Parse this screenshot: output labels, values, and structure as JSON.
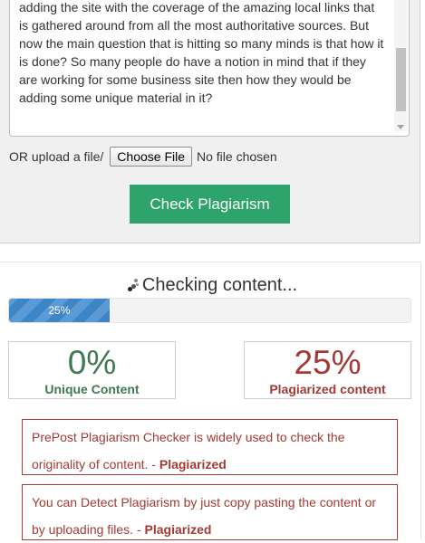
{
  "input": {
    "text": "adding the site with the coverage of the amazing local links that is gathered around from all the most authoritative sources. But now the main question that is hitting so many minds is that how it is done? So many people do have a notion in mind that if they are working for some business site then how they would be adding some unique material in it?"
  },
  "upload": {
    "label": "OR upload a file/",
    "button_label": "Choose File",
    "status": "No file chosen"
  },
  "check_button": {
    "label": "Check Plagiarism"
  },
  "status": {
    "checking_text": "Checking content...",
    "progress_percent": 25,
    "progress_label": "25%"
  },
  "stats": {
    "unique": {
      "value": "0%",
      "label": "Unique Content",
      "color": "#3d7a52"
    },
    "plagiarized": {
      "value": "25%",
      "label": "Plagiarized content",
      "color": "#a33a33"
    }
  },
  "results": [
    {
      "text": "PrePost Plagiarism Checker is widely used to check the originality of content. - ",
      "verdict": "Plagiarized"
    },
    {
      "text": "You can Detect Plagiarism by just copy pasting the content or by uploading files. - ",
      "verdict": "Plagiarized"
    }
  ],
  "colors": {
    "accent_button": "#2ea36b",
    "progress": "#3d85c6",
    "plagiarized": "#a33a33",
    "unique": "#3d7a52"
  },
  "icons": {
    "spinner": "loading-spinner-icon",
    "scroll_arrow": "chevron-down-icon"
  }
}
